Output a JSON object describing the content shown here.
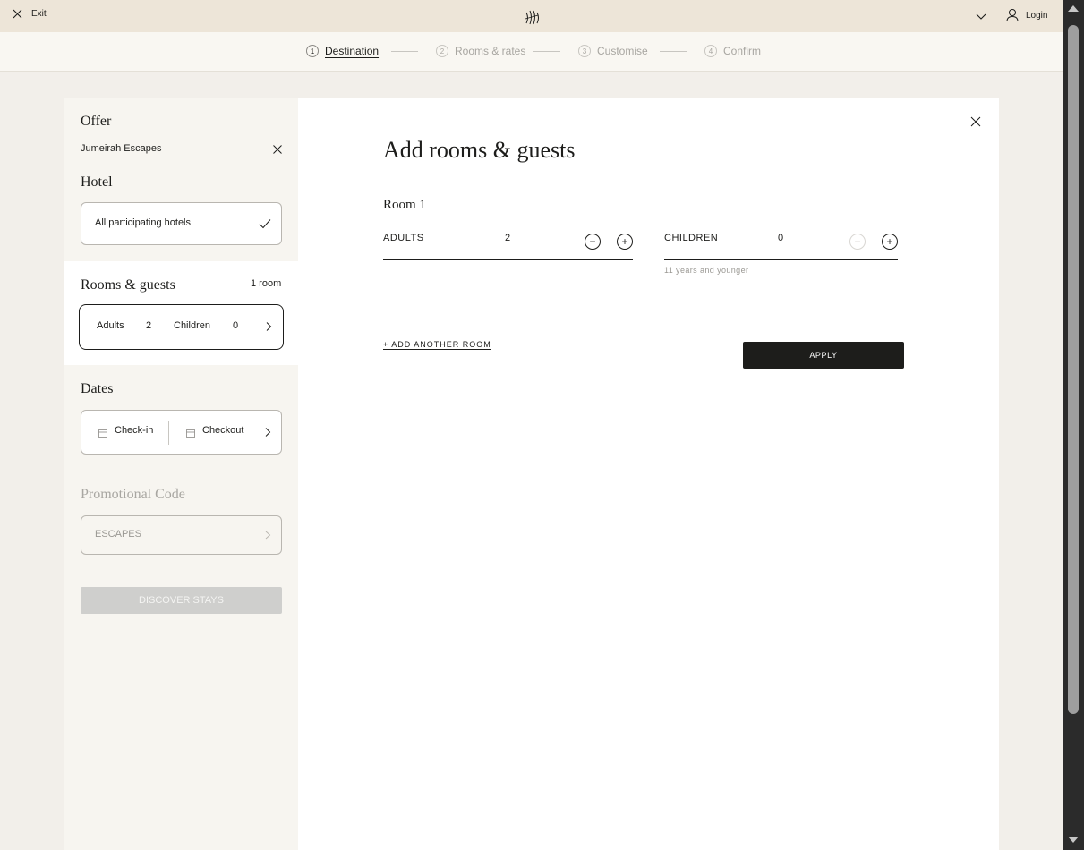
{
  "topbar": {
    "exit_label": "Exit",
    "login_label": "Login"
  },
  "stepper": {
    "steps": [
      {
        "num": "1",
        "label": "Destination"
      },
      {
        "num": "2",
        "label": "Rooms & rates"
      },
      {
        "num": "3",
        "label": "Customise"
      },
      {
        "num": "4",
        "label": "Confirm"
      }
    ]
  },
  "sidebar": {
    "offer_title": "Offer",
    "offer_value": "Jumeirah Escapes",
    "hotel_title": "Hotel",
    "hotel_value": "All participating hotels",
    "rooms_title": "Rooms & guests",
    "rooms_count": "1 room",
    "adults_label": "Adults",
    "adults_value": "2",
    "children_label": "Children",
    "children_value": "0",
    "dates_title": "Dates",
    "checkin_label": "Check-in",
    "checkout_label": "Checkout",
    "promo_title": "Promotional Code",
    "promo_value": "ESCAPES",
    "discover_label": "DISCOVER STAYS"
  },
  "main": {
    "title": "Add rooms & guests",
    "room_title": "Room 1",
    "adults_label": "ADULTS",
    "adults_value": "2",
    "children_label": "CHILDREN",
    "children_value": "0",
    "children_hint": "11 years and younger",
    "add_room_label": "+ ADD ANOTHER ROOM",
    "apply_label": "APPLY"
  }
}
